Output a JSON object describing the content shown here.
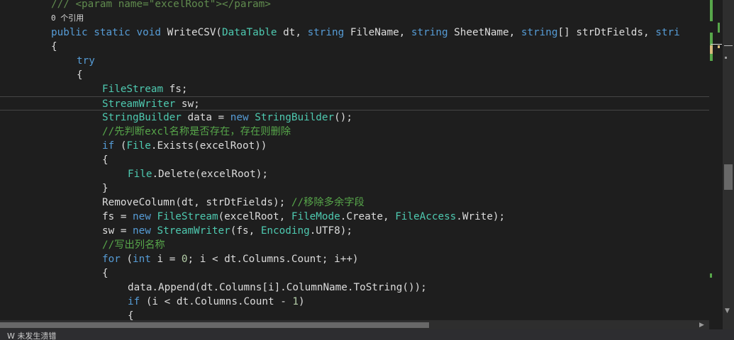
{
  "editor": {
    "lines": [
      {
        "indent": 72,
        "codelens": false,
        "tokens": [
          [
            "doc",
            "/// "
          ],
          [
            "doc",
            "<param name=\"excelRoot\"></param>"
          ]
        ]
      },
      {
        "indent": 72,
        "codelens": true,
        "tokens": [
          [
            "pl",
            "0 个引用"
          ]
        ]
      },
      {
        "indent": 72,
        "codelens": false,
        "tokens": [
          [
            "kw",
            "public"
          ],
          [
            "pl",
            " "
          ],
          [
            "kw",
            "static"
          ],
          [
            "pl",
            " "
          ],
          [
            "kw",
            "void"
          ],
          [
            "pl",
            " WriteCSV("
          ],
          [
            "type",
            "DataTable"
          ],
          [
            "pl",
            " dt, "
          ],
          [
            "kw",
            "string"
          ],
          [
            "pl",
            " FileName, "
          ],
          [
            "kw",
            "string"
          ],
          [
            "pl",
            " SheetName, "
          ],
          [
            "kw",
            "string"
          ],
          [
            "pl",
            "[] strDtFields, "
          ],
          [
            "kw",
            "stri"
          ]
        ]
      },
      {
        "indent": 72,
        "codelens": false,
        "tokens": [
          [
            "pl",
            "{"
          ]
        ]
      },
      {
        "indent": 108,
        "codelens": false,
        "tokens": [
          [
            "kw",
            "try"
          ]
        ]
      },
      {
        "indent": 108,
        "codelens": false,
        "tokens": [
          [
            "pl",
            "{"
          ]
        ]
      },
      {
        "indent": 144,
        "codelens": false,
        "tokens": [
          [
            "type",
            "FileStream"
          ],
          [
            "pl",
            " fs;"
          ]
        ]
      },
      {
        "indent": 144,
        "codelens": false,
        "current": true,
        "tokens": [
          [
            "type",
            "StreamWriter"
          ],
          [
            "pl",
            " sw;"
          ]
        ]
      },
      {
        "indent": 144,
        "codelens": false,
        "tokens": [
          [
            "type",
            "StringBuilder"
          ],
          [
            "pl",
            " data = "
          ],
          [
            "kw",
            "new"
          ],
          [
            "pl",
            " "
          ],
          [
            "type",
            "StringBuilder"
          ],
          [
            "pl",
            "();"
          ]
        ]
      },
      {
        "indent": 144,
        "codelens": false,
        "tokens": [
          [
            "cm",
            "//先判断excl名称是否存在，存在则删除"
          ]
        ]
      },
      {
        "indent": 144,
        "codelens": false,
        "tokens": [
          [
            "kw",
            "if"
          ],
          [
            "pl",
            " ("
          ],
          [
            "type",
            "File"
          ],
          [
            "pl",
            ".Exists(excelRoot))"
          ]
        ]
      },
      {
        "indent": 144,
        "codelens": false,
        "tokens": [
          [
            "pl",
            "{"
          ]
        ]
      },
      {
        "indent": 180,
        "codelens": false,
        "tokens": [
          [
            "type",
            "File"
          ],
          [
            "pl",
            ".Delete(excelRoot);"
          ]
        ]
      },
      {
        "indent": 144,
        "codelens": false,
        "tokens": [
          [
            "pl",
            "}"
          ]
        ]
      },
      {
        "indent": 144,
        "codelens": false,
        "tokens": [
          [
            "pl",
            "RemoveColumn(dt, strDtFields); "
          ],
          [
            "cm",
            "//移除多余字段"
          ]
        ]
      },
      {
        "indent": 144,
        "codelens": false,
        "tokens": [
          [
            "pl",
            "fs = "
          ],
          [
            "kw",
            "new"
          ],
          [
            "pl",
            " "
          ],
          [
            "type",
            "FileStream"
          ],
          [
            "pl",
            "(excelRoot, "
          ],
          [
            "type",
            "FileMode"
          ],
          [
            "pl",
            ".Create, "
          ],
          [
            "type",
            "FileAccess"
          ],
          [
            "pl",
            ".Write);"
          ]
        ]
      },
      {
        "indent": 144,
        "codelens": false,
        "tokens": [
          [
            "pl",
            "sw = "
          ],
          [
            "kw",
            "new"
          ],
          [
            "pl",
            " "
          ],
          [
            "type",
            "StreamWriter"
          ],
          [
            "pl",
            "(fs, "
          ],
          [
            "type",
            "Encoding"
          ],
          [
            "pl",
            ".UTF8);"
          ]
        ]
      },
      {
        "indent": 144,
        "codelens": false,
        "tokens": [
          [
            "cm",
            "//写出列名称"
          ]
        ]
      },
      {
        "indent": 144,
        "codelens": false,
        "tokens": [
          [
            "kw",
            "for"
          ],
          [
            "pl",
            " ("
          ],
          [
            "kw",
            "int"
          ],
          [
            "pl",
            " i = "
          ],
          [
            "num",
            "0"
          ],
          [
            "pl",
            "; i < dt.Columns.Count; i++)"
          ]
        ]
      },
      {
        "indent": 144,
        "codelens": false,
        "tokens": [
          [
            "pl",
            "{"
          ]
        ]
      },
      {
        "indent": 180,
        "codelens": false,
        "tokens": [
          [
            "pl",
            "data.Append(dt.Columns[i].ColumnName.ToString());"
          ]
        ]
      },
      {
        "indent": 180,
        "codelens": false,
        "tokens": [
          [
            "kw",
            "if"
          ],
          [
            "pl",
            " (i < dt.Columns.Count - "
          ],
          [
            "num",
            "1"
          ],
          [
            "pl",
            ")"
          ]
        ]
      },
      {
        "indent": 180,
        "codelens": false,
        "tokens": [
          [
            "pl",
            "{"
          ]
        ]
      }
    ]
  },
  "status": {
    "text": "W 未发生溃错"
  },
  "colors": {
    "background": "#1e1e1e",
    "keyword": "#569cd6",
    "type": "#4ec9b0",
    "comment": "#57a64a",
    "change_marker": "#57a64a",
    "warning_marker": "#d7ba7d"
  },
  "scrollbars": {
    "left_arrow_icon": "triangle-left",
    "right_arrow_icon": "triangle-right"
  }
}
